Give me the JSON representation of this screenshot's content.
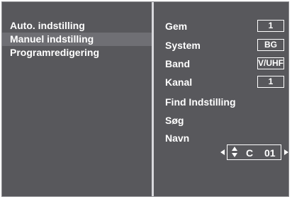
{
  "left_menu": {
    "items": [
      {
        "label": "Auto. indstilling",
        "active": false
      },
      {
        "label": "Manuel indstilling",
        "active": true
      },
      {
        "label": "Programredigering",
        "active": false
      }
    ]
  },
  "right_panel": {
    "rows": [
      {
        "label": "Gem",
        "value": "1"
      },
      {
        "label": "System",
        "value": "BG"
      },
      {
        "label": "Band",
        "value": "V/UHF"
      },
      {
        "label": "Kanal",
        "value": "1"
      },
      {
        "label": "Find Indstilling"
      },
      {
        "label": "Søg"
      },
      {
        "label": "Navn"
      }
    ],
    "name_editor": {
      "letter": "C",
      "number": "01"
    }
  },
  "colors": {
    "panel_bg": "#58585c",
    "highlight": "#6f6f74",
    "text": "#ffffff",
    "divider": "#d8d8dc"
  }
}
